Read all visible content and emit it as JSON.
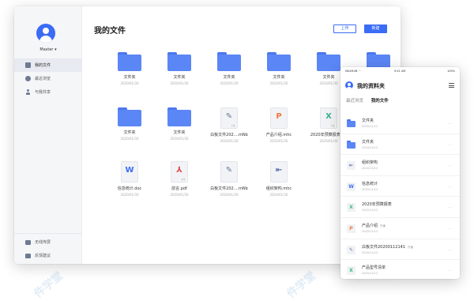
{
  "desktop": {
    "sidebar": {
      "user": "Master ▾",
      "nav": [
        "我的文件",
        "最近浏览",
        "与我共享"
      ],
      "bottom": [
        "无线传屏",
        "反馈建议"
      ]
    },
    "title": "我的文件",
    "upload": "上传",
    "new": "新建",
    "files": [
      {
        "name": "文件夹",
        "date": "2020/01/30",
        "kind": "folder",
        "glyph": "",
        "tag": ""
      },
      {
        "name": "文件夹",
        "date": "2020/01/30",
        "kind": "folder",
        "glyph": "",
        "tag": ""
      },
      {
        "name": "文件夹",
        "date": "2020/01/30",
        "kind": "folder",
        "glyph": "",
        "tag": ""
      },
      {
        "name": "文件夹",
        "date": "2020/01/30",
        "kind": "folder",
        "glyph": "",
        "tag": ""
      },
      {
        "name": "文件夹",
        "date": "2020/01/30",
        "kind": "folder",
        "glyph": "",
        "tag": ""
      },
      {
        "name": "文件夹",
        "date": "2020/01/30",
        "kind": "folder",
        "glyph": "",
        "tag": ""
      },
      {
        "name": "文件夹",
        "date": "2020/01/30",
        "kind": "folder",
        "glyph": "",
        "tag": ""
      },
      {
        "name": "文件夹",
        "date": "2020/01/30",
        "kind": "folder",
        "glyph": "",
        "tag": ""
      },
      {
        "name": "白板文件202....mNb",
        "date": "2020/01/30",
        "kind": "doc",
        "glyph": "✎",
        "tag": "只读",
        "cls": "g-pen"
      },
      {
        "name": "产品介绍.mhc",
        "date": "2020/01/30",
        "kind": "doc",
        "glyph": "P",
        "tag": "",
        "cls": "g-p"
      },
      {
        "name": "2020年预算报表.xsl",
        "date": "2020/01/30",
        "kind": "doc",
        "glyph": "X",
        "tag": "只读",
        "cls": "g-x"
      },
      {
        "name": "信息统计.doc",
        "date": "2020/01/30",
        "kind": "doc",
        "glyph": "W",
        "tag": "",
        "cls": "g-w"
      },
      {
        "name": "前言.pdf",
        "date": "2020/01/30",
        "kind": "doc",
        "glyph": "⅄",
        "tag": "共享",
        "cls": "g-pdf"
      },
      {
        "name": "白板文件202....mNb",
        "date": "2020/01/30",
        "kind": "doc",
        "glyph": "✎",
        "tag": "",
        "cls": "g-pen"
      },
      {
        "name": "组织架构.mhc",
        "date": "2020/01/30",
        "kind": "doc",
        "glyph": "⇤",
        "tag": "",
        "cls": "g-mind"
      }
    ]
  },
  "phone": {
    "carrier": "MAXHUB ◠",
    "time": "9:41 AM",
    "battery": "100%",
    "title": "我的资料夹",
    "tabs": [
      "最近浏览",
      "我的文件"
    ],
    "more": "···",
    "rows": [
      {
        "name": "文件夹",
        "date": "2020/11/12",
        "kind": "folder",
        "glyph": "",
        "tag": ""
      },
      {
        "name": "文件夹",
        "date": "2020/11/12",
        "kind": "folder",
        "glyph": "",
        "tag": ""
      },
      {
        "name": "组织架构",
        "date": "2020/11/12",
        "kind": "doc",
        "glyph": "⇤",
        "tag": "",
        "cls": "g-mind"
      },
      {
        "name": "信息统计",
        "date": "2020/11/12",
        "kind": "doc",
        "glyph": "W",
        "tag": "",
        "cls": "g-w"
      },
      {
        "name": "2020年预算报表",
        "date": "2020/11/12",
        "kind": "doc",
        "glyph": "X",
        "tag": "",
        "cls": "g-x"
      },
      {
        "name": "产品介绍",
        "date": "2020/11/12",
        "kind": "doc",
        "glyph": "P",
        "tag": "只读",
        "cls": "g-p"
      },
      {
        "name": "白板文件20200112141",
        "date": "2020/11/12",
        "kind": "doc",
        "glyph": "✎",
        "tag": "只读",
        "cls": "g-pen"
      },
      {
        "name": "产品型号清单",
        "date": "2020/11/12",
        "kind": "doc",
        "glyph": "X",
        "tag": "",
        "cls": "g-x"
      }
    ]
  },
  "watermarks": [
    "亿",
    "件学",
    "堂",
    "www.ue51.com",
    "学堂",
    "亿",
    "件学堂",
    "件学堂"
  ]
}
